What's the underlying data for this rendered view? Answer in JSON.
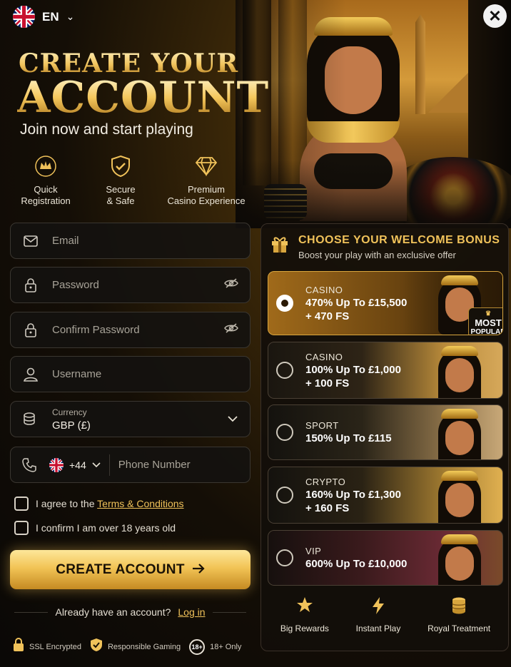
{
  "language": {
    "code": "EN"
  },
  "hero": {
    "title_line1": "CREATE YOUR",
    "title_line2": "ACCOUNT",
    "subtitle": "Join now and start playing"
  },
  "features": [
    {
      "label": "Quick\nRegistration",
      "icon": "crown-icon"
    },
    {
      "label": "Secure\n& Safe",
      "icon": "shield-check-icon"
    },
    {
      "label": "Premium\nCasino Experience",
      "icon": "diamond-icon"
    }
  ],
  "form": {
    "email_placeholder": "Email",
    "password_placeholder": "Password",
    "confirm_password_placeholder": "Confirm Password",
    "username_placeholder": "Username",
    "currency_label": "Currency",
    "currency_value": "GBP (£)",
    "phone_code": "+44",
    "phone_placeholder": "Phone Number",
    "terms_prefix": "I agree to the",
    "terms_link": "Terms & Conditions",
    "age_confirm": "I confirm I am over 18 years old",
    "submit_label": "CREATE ACCOUNT",
    "login_prompt": "Already have an account?",
    "login_link": "Log in"
  },
  "trust_badges": [
    {
      "label": "SSL Encrypted",
      "icon": "lock-icon"
    },
    {
      "label": "Responsible Gaming",
      "icon": "shield-check-icon"
    },
    {
      "label": "18+ Only",
      "icon_text": "18+"
    }
  ],
  "bonus": {
    "title": "CHOOSE YOUR WELCOME BONUS",
    "subtitle": "Boost your play with an exclusive offer",
    "options": [
      {
        "category": "CASINO",
        "line1": "470% Up To £15,500",
        "line2": "+ 470 FS",
        "selected": true,
        "badge_line1": "MOST",
        "badge_line2": "POPULAR"
      },
      {
        "category": "CASINO",
        "line1": "100% Up To £1,000",
        "line2": "+ 100 FS",
        "selected": false
      },
      {
        "category": "SPORT",
        "line1": "150% Up To £115",
        "line2": "",
        "selected": false
      },
      {
        "category": "CRYPTO",
        "line1": "160% Up To £1,300",
        "line2": "+ 160 FS",
        "selected": false
      },
      {
        "category": "VIP",
        "line1": "600% Up To £10,000",
        "line2": "",
        "selected": false
      }
    ],
    "perks": [
      {
        "label": "Big Rewards",
        "icon": "star-icon"
      },
      {
        "label": "Instant Play",
        "icon": "lightning-icon"
      },
      {
        "label": "Royal Treatment",
        "icon": "coins-icon"
      }
    ]
  },
  "colors": {
    "accent": "#f0c25a",
    "background": "#0b0906"
  }
}
